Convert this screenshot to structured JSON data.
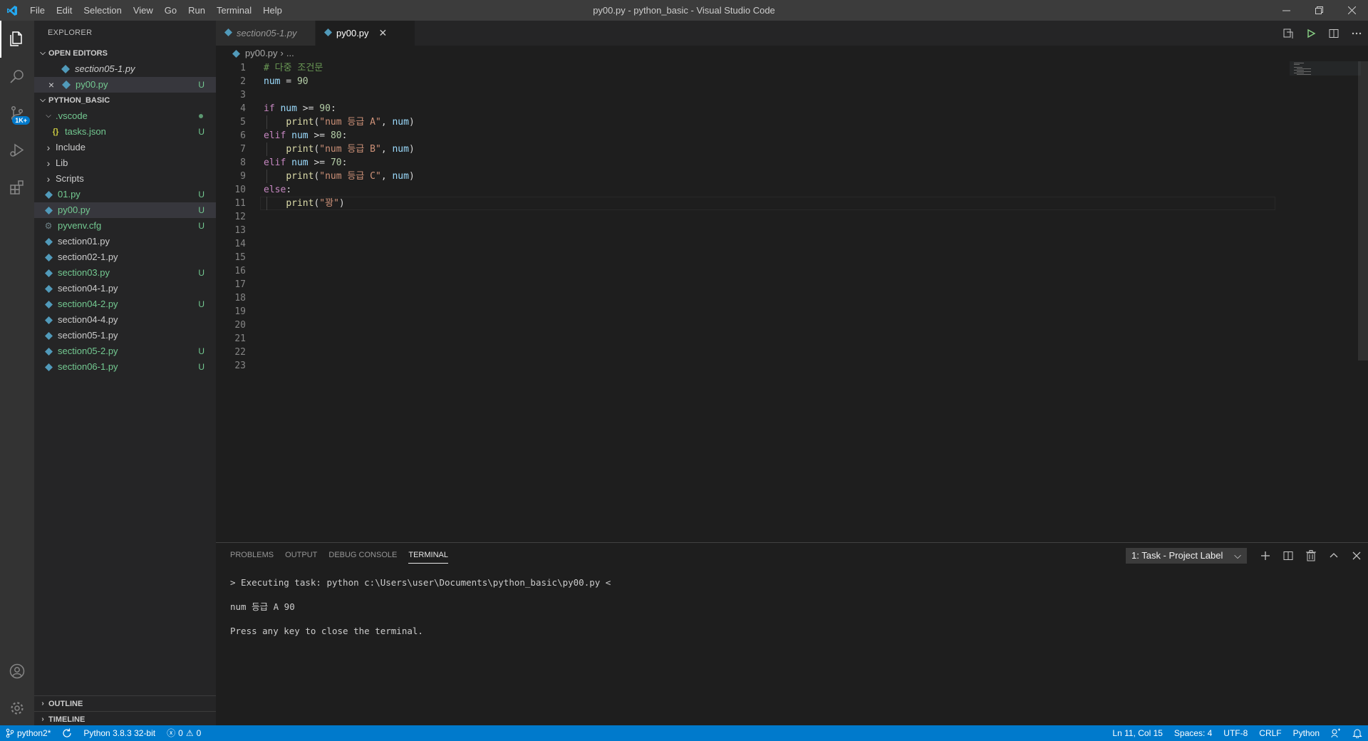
{
  "window": {
    "title": "py00.py - python_basic - Visual Studio Code",
    "menu": [
      "File",
      "Edit",
      "Selection",
      "View",
      "Go",
      "Run",
      "Terminal",
      "Help"
    ]
  },
  "activity": {
    "source_control_badge": "1K+"
  },
  "sidebar": {
    "title": "EXPLORER",
    "open_editors_label": "OPEN EDITORS",
    "open_editors": [
      {
        "name": "section05-1.py",
        "status": ""
      },
      {
        "name": "py00.py",
        "status": "U"
      }
    ],
    "project_label": "PYTHON_BASIC",
    "tree": [
      {
        "name": ".vscode",
        "kind": "folder-open",
        "status": "dot"
      },
      {
        "name": "tasks.json",
        "kind": "json",
        "status": "U"
      },
      {
        "name": "Include",
        "kind": "folder",
        "status": ""
      },
      {
        "name": "Lib",
        "kind": "folder",
        "status": ""
      },
      {
        "name": "Scripts",
        "kind": "folder",
        "status": ""
      },
      {
        "name": "01.py",
        "kind": "py",
        "status": "U"
      },
      {
        "name": "py00.py",
        "kind": "py",
        "status": "U"
      },
      {
        "name": "pyvenv.cfg",
        "kind": "cfg",
        "status": "U"
      },
      {
        "name": "section01.py",
        "kind": "py",
        "status": ""
      },
      {
        "name": "section02-1.py",
        "kind": "py",
        "status": ""
      },
      {
        "name": "section03.py",
        "kind": "py",
        "status": "U"
      },
      {
        "name": "section04-1.py",
        "kind": "py",
        "status": ""
      },
      {
        "name": "section04-2.py",
        "kind": "py",
        "status": "U"
      },
      {
        "name": "section04-4.py",
        "kind": "py",
        "status": ""
      },
      {
        "name": "section05-1.py",
        "kind": "py",
        "status": ""
      },
      {
        "name": "section05-2.py",
        "kind": "py",
        "status": "U"
      },
      {
        "name": "section06-1.py",
        "kind": "py",
        "status": "U"
      }
    ],
    "outline_label": "OUTLINE",
    "timeline_label": "TIMELINE"
  },
  "tabs": [
    {
      "name": "section05-1.py",
      "active": false
    },
    {
      "name": "py00.py",
      "active": true
    }
  ],
  "breadcrumb": {
    "file": "py00.py",
    "rest": "..."
  },
  "editor": {
    "lines": [
      "# 다중 조건문",
      "num = 90",
      "",
      "if num >= 90:",
      "    print(\"num 등급 A\", num)",
      "elif num >= 80:",
      "    print(\"num 등급 B\", num)",
      "elif num >= 70:",
      "    print(\"num 등급 C\", num)",
      "else:",
      "    print(\"꽝\")",
      "",
      "",
      "",
      "",
      "",
      "",
      "",
      "",
      "",
      "",
      "",
      ""
    ],
    "current_line": 11
  },
  "panel": {
    "tabs": [
      "PROBLEMS",
      "OUTPUT",
      "DEBUG CONSOLE",
      "TERMINAL"
    ],
    "active_tab": "TERMINAL",
    "terminal_select": "1: Task - Project Label",
    "terminal_lines": [
      "> Executing task: python c:\\Users\\user\\Documents\\python_basic\\py00.py <",
      "num 등급 A 90",
      "Press any key to close the terminal."
    ]
  },
  "status": {
    "branch": "python2*",
    "interpreter": "Python 3.8.3 32-bit",
    "errors": "0",
    "warnings": "0",
    "position": "Ln 11, Col 15",
    "spaces": "Spaces: 4",
    "encoding": "UTF-8",
    "eol": "CRLF",
    "language": "Python"
  },
  "colors": {
    "accent": "#007acc",
    "git_untracked": "#73c991",
    "python_icon": "#519aba"
  }
}
